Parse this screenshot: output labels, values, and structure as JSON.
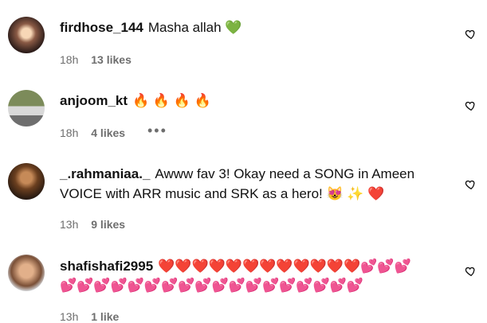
{
  "comments": [
    {
      "username": "firdhose_144",
      "text": "Masha allah 💚",
      "time": "18h",
      "likes": "13 likes"
    },
    {
      "username": "anjoom_kt",
      "text": "🔥 🔥 🔥 🔥",
      "time": "18h",
      "likes": "4 likes",
      "more": "•••"
    },
    {
      "username": "_.rahmaniaa._",
      "text_line1": "Awww fav 3! Okay need a SONG in Ameen",
      "text_line2": "VOICE with ARR music and SRK as a hero! 😻 ✨ ❤️",
      "time": "13h",
      "likes": "9 likes"
    },
    {
      "username": "shafishafi2995",
      "hearts_line1": "❤️❤️❤️❤️❤️❤️❤️❤️❤️❤️❤️❤️💕💕💕",
      "hearts_line2": "💕💕💕💕💕💕💕💕💕💕💕💕💕💕💕💕💕💕",
      "time": "13h",
      "likes": "1 like"
    }
  ],
  "icons": {
    "like": "heart-outline-icon",
    "more": "more-options-icon"
  }
}
